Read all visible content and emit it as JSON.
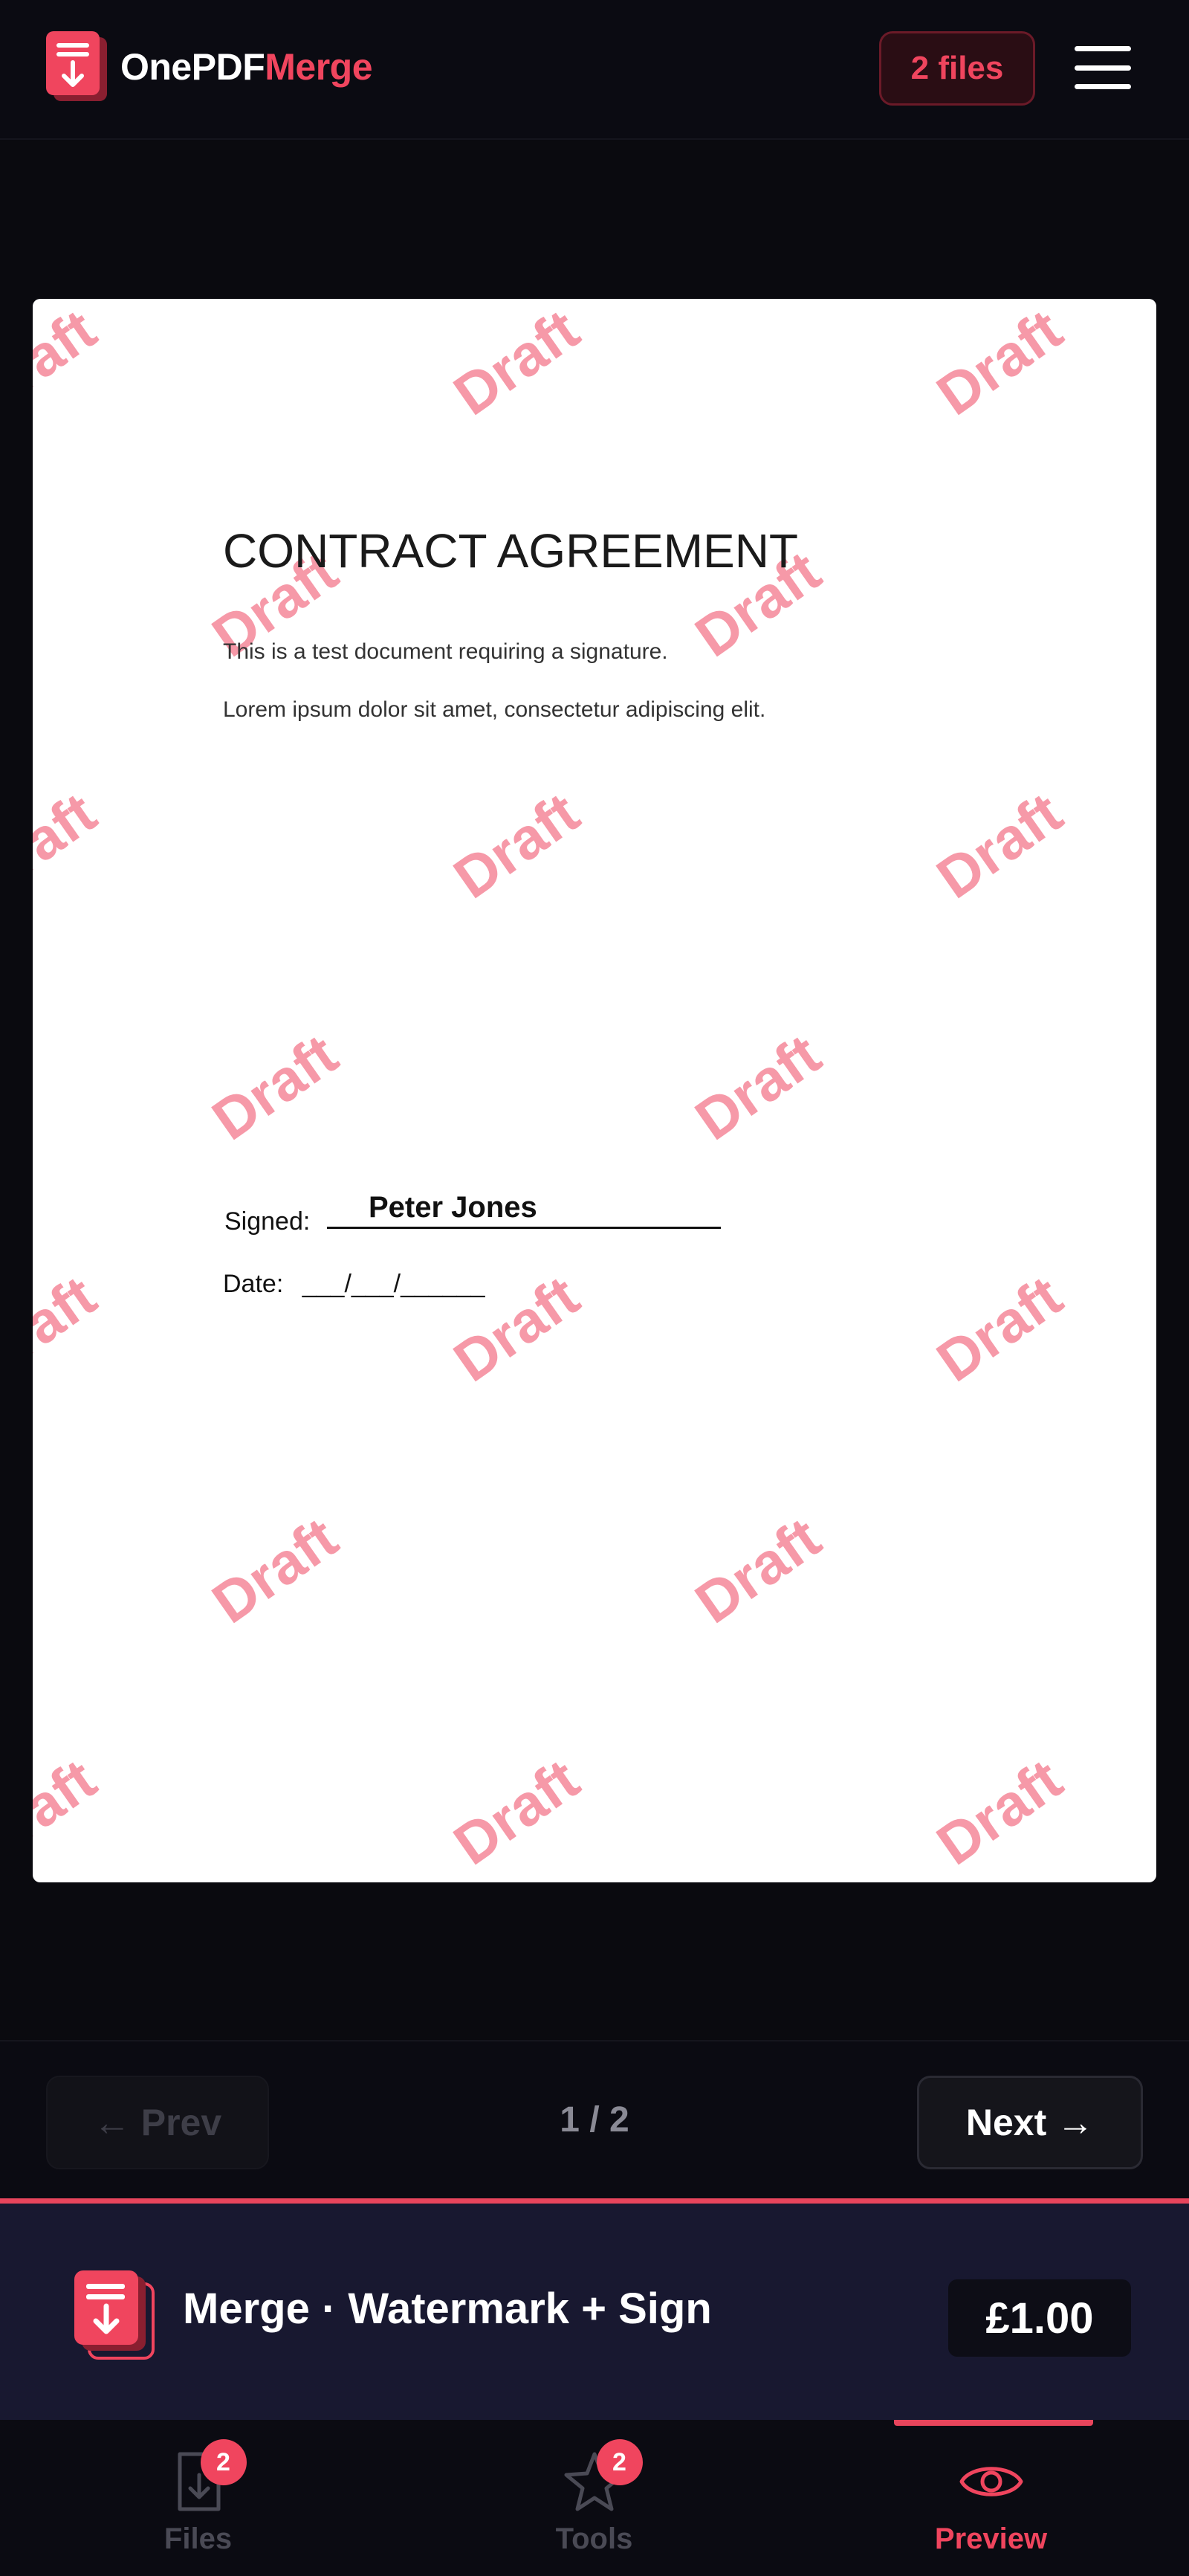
{
  "header": {
    "brand_part1": "OnePDF",
    "brand_part2": "Merge",
    "files_badge": "2 files",
    "logo_icon": "pdf-stack-icon",
    "menu_icon": "hamburger-menu-icon"
  },
  "document": {
    "title": "CONTRACT AGREEMENT",
    "line1": "This is a test document requiring a signature.",
    "line2": "Lorem ipsum dolor sit amet, consectetur adipiscing elit.",
    "signed_label": "Signed:",
    "signature_name": "Peter Jones",
    "date_label": "Date:",
    "date_blank": "___/___/______",
    "watermark_text": "Draft"
  },
  "pager": {
    "prev_label": "← Prev",
    "next_label": "Next →",
    "page_indicator": "1 / 2"
  },
  "summary": {
    "title": "Merge · Watermark + Sign",
    "price": "£1.00"
  },
  "nav": {
    "items": [
      {
        "label": "Files",
        "icon": "file-download-icon",
        "badge": "2"
      },
      {
        "label": "Tools",
        "icon": "star-icon",
        "badge": "2"
      },
      {
        "label": "Preview",
        "icon": "eye-icon",
        "active": true
      }
    ]
  },
  "colors": {
    "accent": "#f0455e",
    "background": "#0a0a0f",
    "summary_bg": "#181830"
  }
}
